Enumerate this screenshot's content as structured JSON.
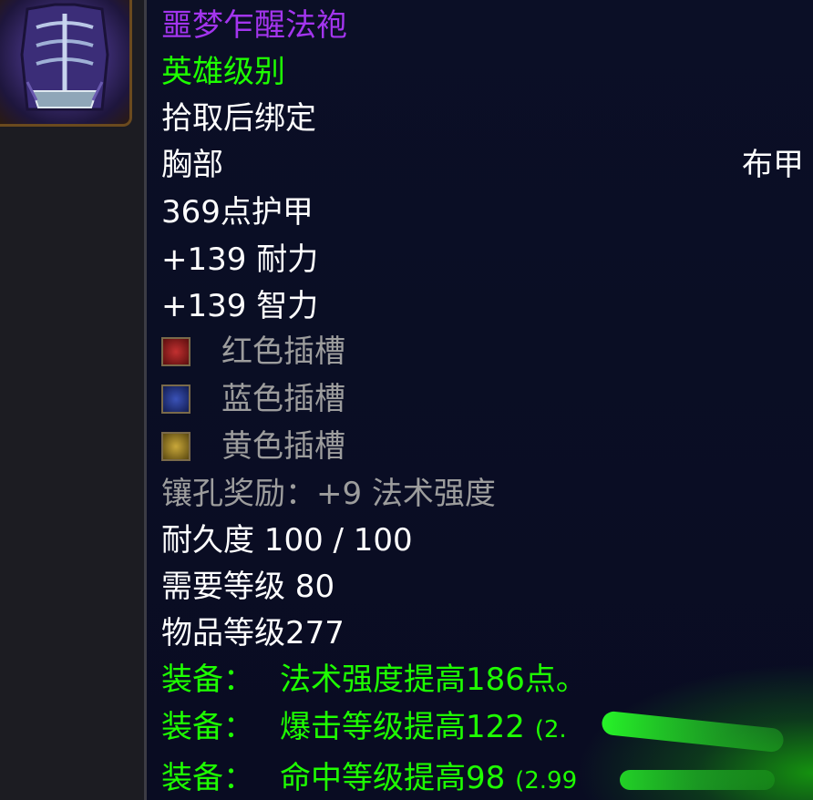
{
  "item": {
    "name": "噩梦乍醒法袍",
    "quality": "英雄级别",
    "binding": "拾取后绑定",
    "slot": "胸部",
    "armor_type": "布甲",
    "armor": "369点护甲",
    "stats": [
      "+139 耐力",
      "+139 智力"
    ],
    "sockets": [
      {
        "label": "红色插槽",
        "color": "#8b1c1c",
        "icon": "red-socket-icon"
      },
      {
        "label": "蓝色插槽",
        "color": "#1e2f7a",
        "icon": "blue-socket-icon"
      },
      {
        "label": "黄色插槽",
        "color": "#8a7420",
        "icon": "yellow-socket-icon"
      }
    ],
    "socket_bonus": "镶孔奖励：+9 法术强度",
    "durability": "耐久度 100 / 100",
    "required_level": "需要等级 80",
    "item_level": "物品等级277",
    "equip_label": "装备：",
    "equips": [
      {
        "text": "法术强度提高186点。",
        "extra": ""
      },
      {
        "text": "爆击等级提高122",
        "extra": "(2."
      },
      {
        "text": "命中等级提高98",
        "extra": "(2.99"
      }
    ]
  },
  "colors": {
    "epic": "#a335ee",
    "uncommon": "#1eff00",
    "white": "#ffffff",
    "gray": "#9d9d9d"
  }
}
